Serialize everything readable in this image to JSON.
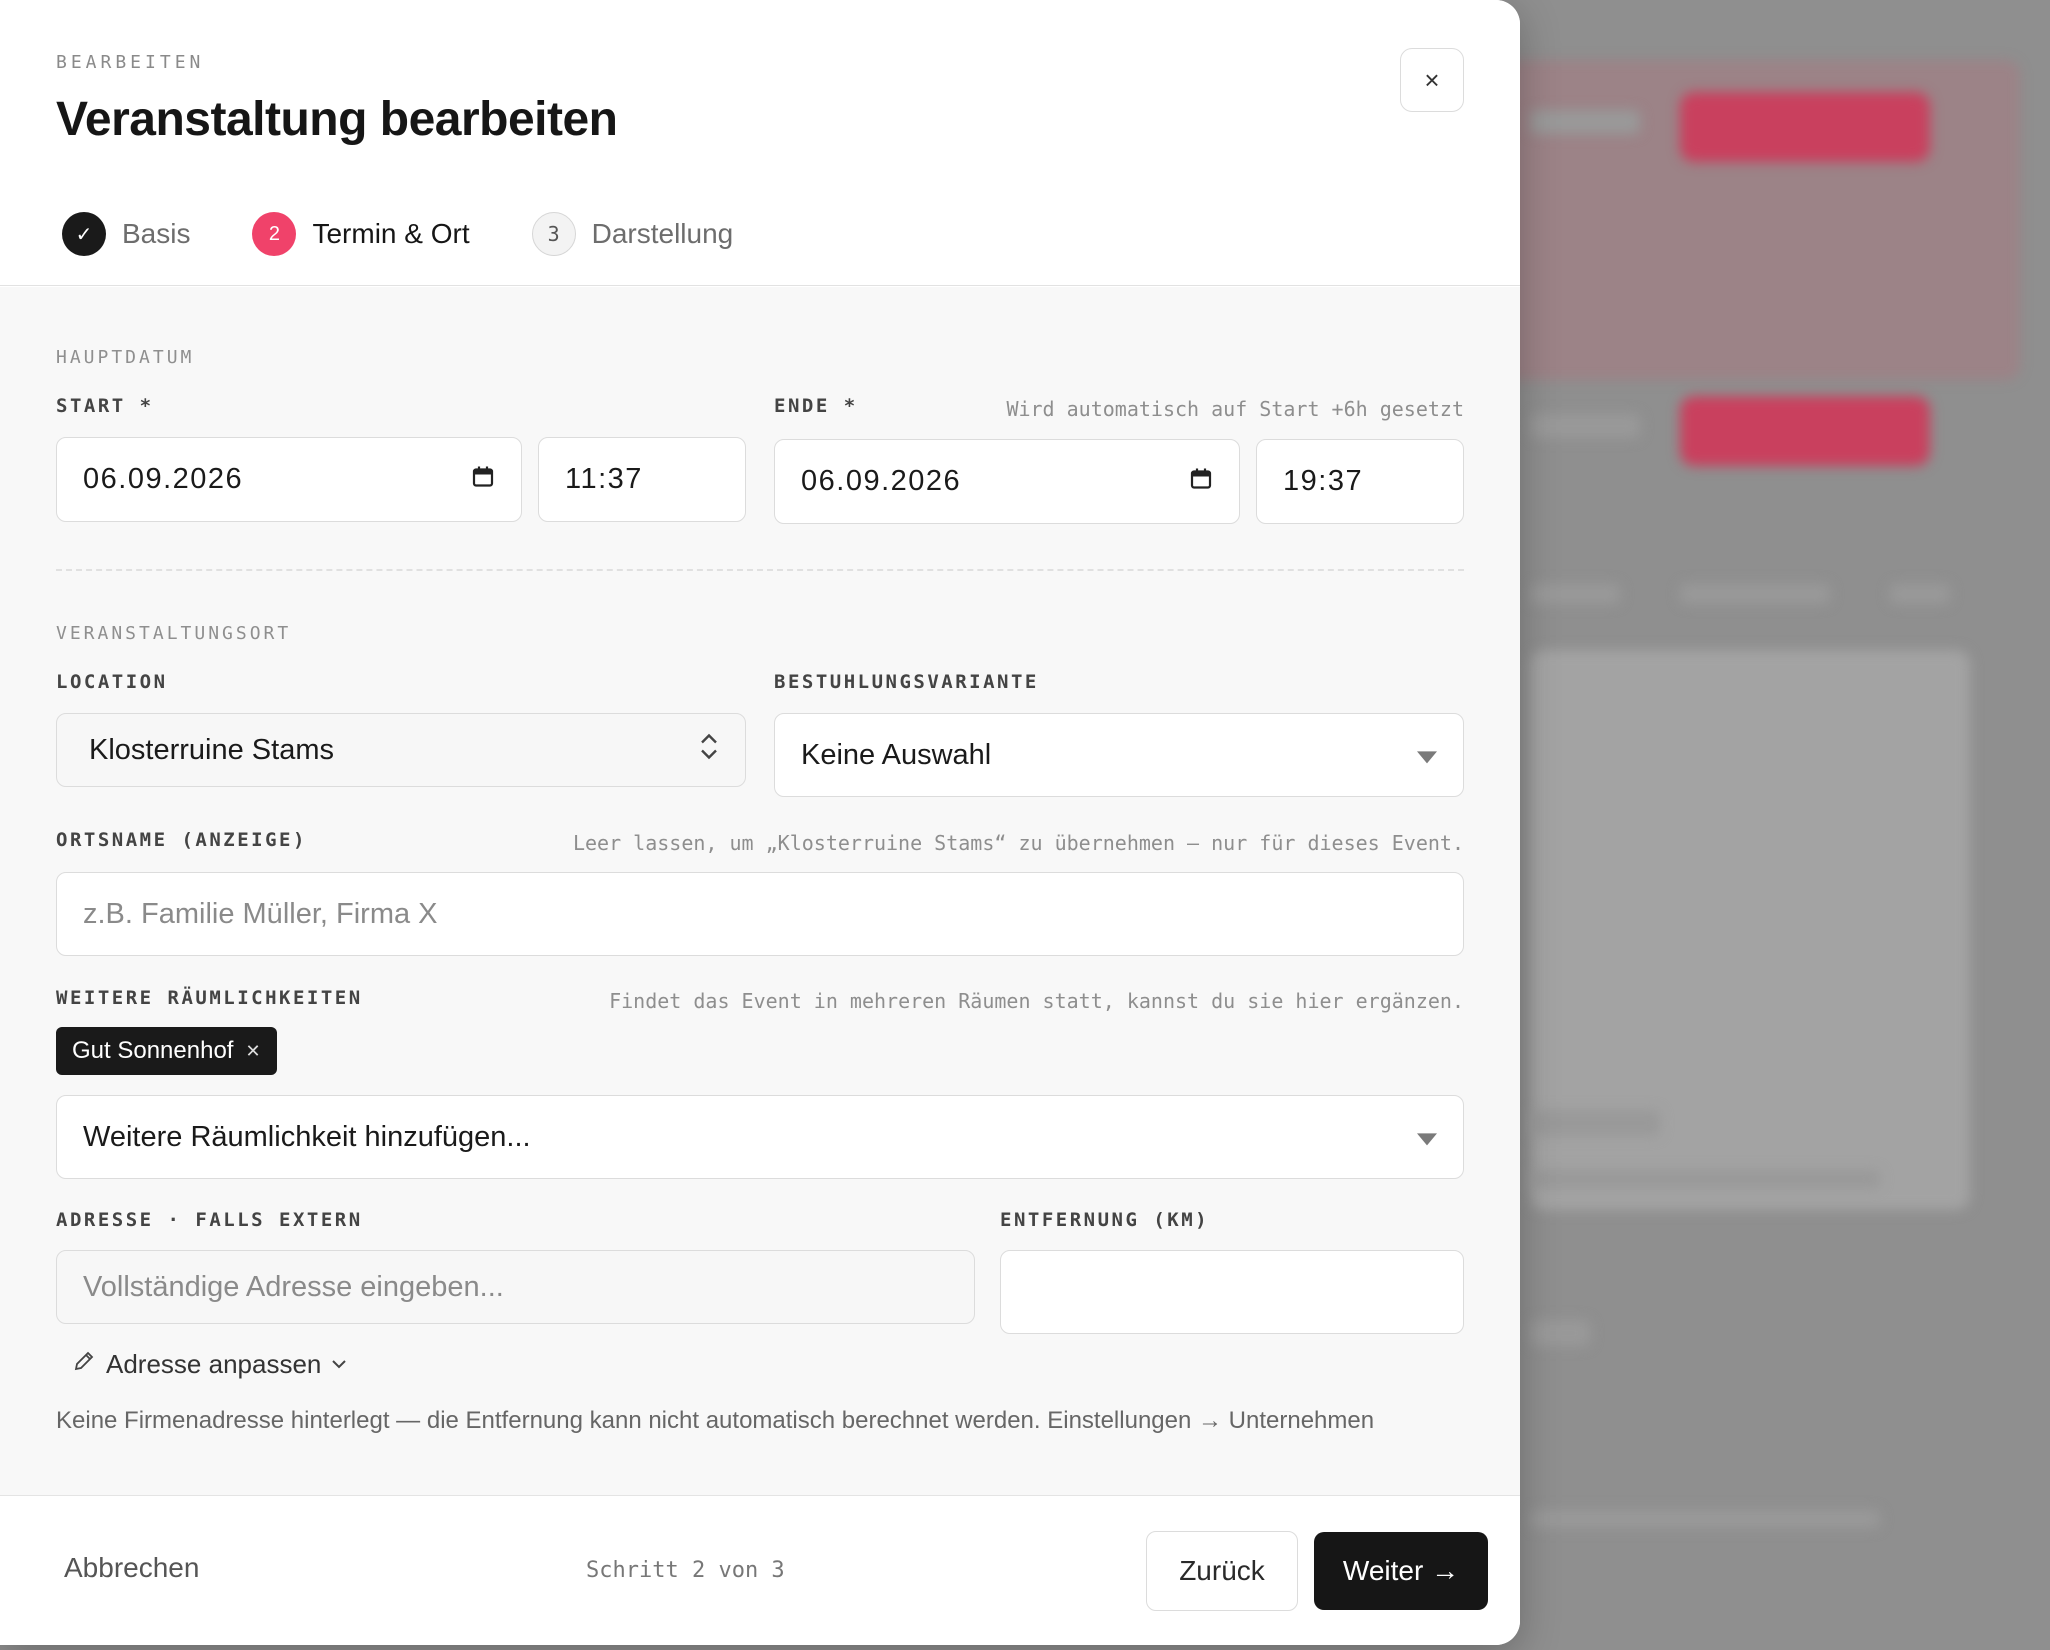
{
  "modal": {
    "eyebrow": "BEARBEITEN",
    "title": "Veranstaltung bearbeiten",
    "close_icon": "×"
  },
  "steps": [
    {
      "marker": "✓",
      "label": "Basis",
      "state": "done"
    },
    {
      "marker": "2",
      "label": "Termin & Ort",
      "state": "active"
    },
    {
      "marker": "3",
      "label": "Darstellung",
      "state": "pending"
    }
  ],
  "main_date": {
    "section": "HAUPTDATUM",
    "start_label": "START *",
    "start_date": "06.09.2026",
    "start_time": "11:37",
    "end_label": "ENDE *",
    "end_hint": "Wird automatisch auf Start +6h gesetzt",
    "end_date": "06.09.2026",
    "end_time": "19:37"
  },
  "venue": {
    "section": "VERANSTALTUNGSORT",
    "location_label": "LOCATION",
    "location_value": "Klosterruine Stams",
    "seating_label": "BESTUHLUNGSVARIANTE",
    "seating_value": "Keine Auswahl",
    "placename_label": "ORTSNAME (ANZEIGE)",
    "placename_hint": "Leer lassen, um „Klosterruine Stams“ zu übernehmen — nur für dieses Event.",
    "placename_placeholder": "z.B. Familie Müller, Firma X",
    "rooms_label": "WEITERE RÄUMLICHKEITEN",
    "rooms_hint": "Findet das Event in mehreren Räumen statt, kannst du sie hier ergänzen.",
    "rooms_chips": [
      "Gut Sonnenhof"
    ],
    "rooms_placeholder": "Weitere Räumlichkeit hinzufügen...",
    "address_label": "ADRESSE · FALLS EXTERN",
    "address_placeholder": "Vollständige Adresse eingeben...",
    "distance_label": "ENTFERNUNG (KM)",
    "distance_value": "",
    "adjust_label": "Adresse anpassen",
    "note": "Keine Firmenadresse hinterlegt — die Entfernung kann nicht automatisch berechnet werden. Einstellungen → Unternehmen"
  },
  "footer": {
    "cancel": "Abbrechen",
    "step_info": "Schritt 2 von 3",
    "back": "Zurück",
    "next": "Weiter →"
  },
  "colors": {
    "accent": "#f0426a",
    "dark": "#161616"
  }
}
